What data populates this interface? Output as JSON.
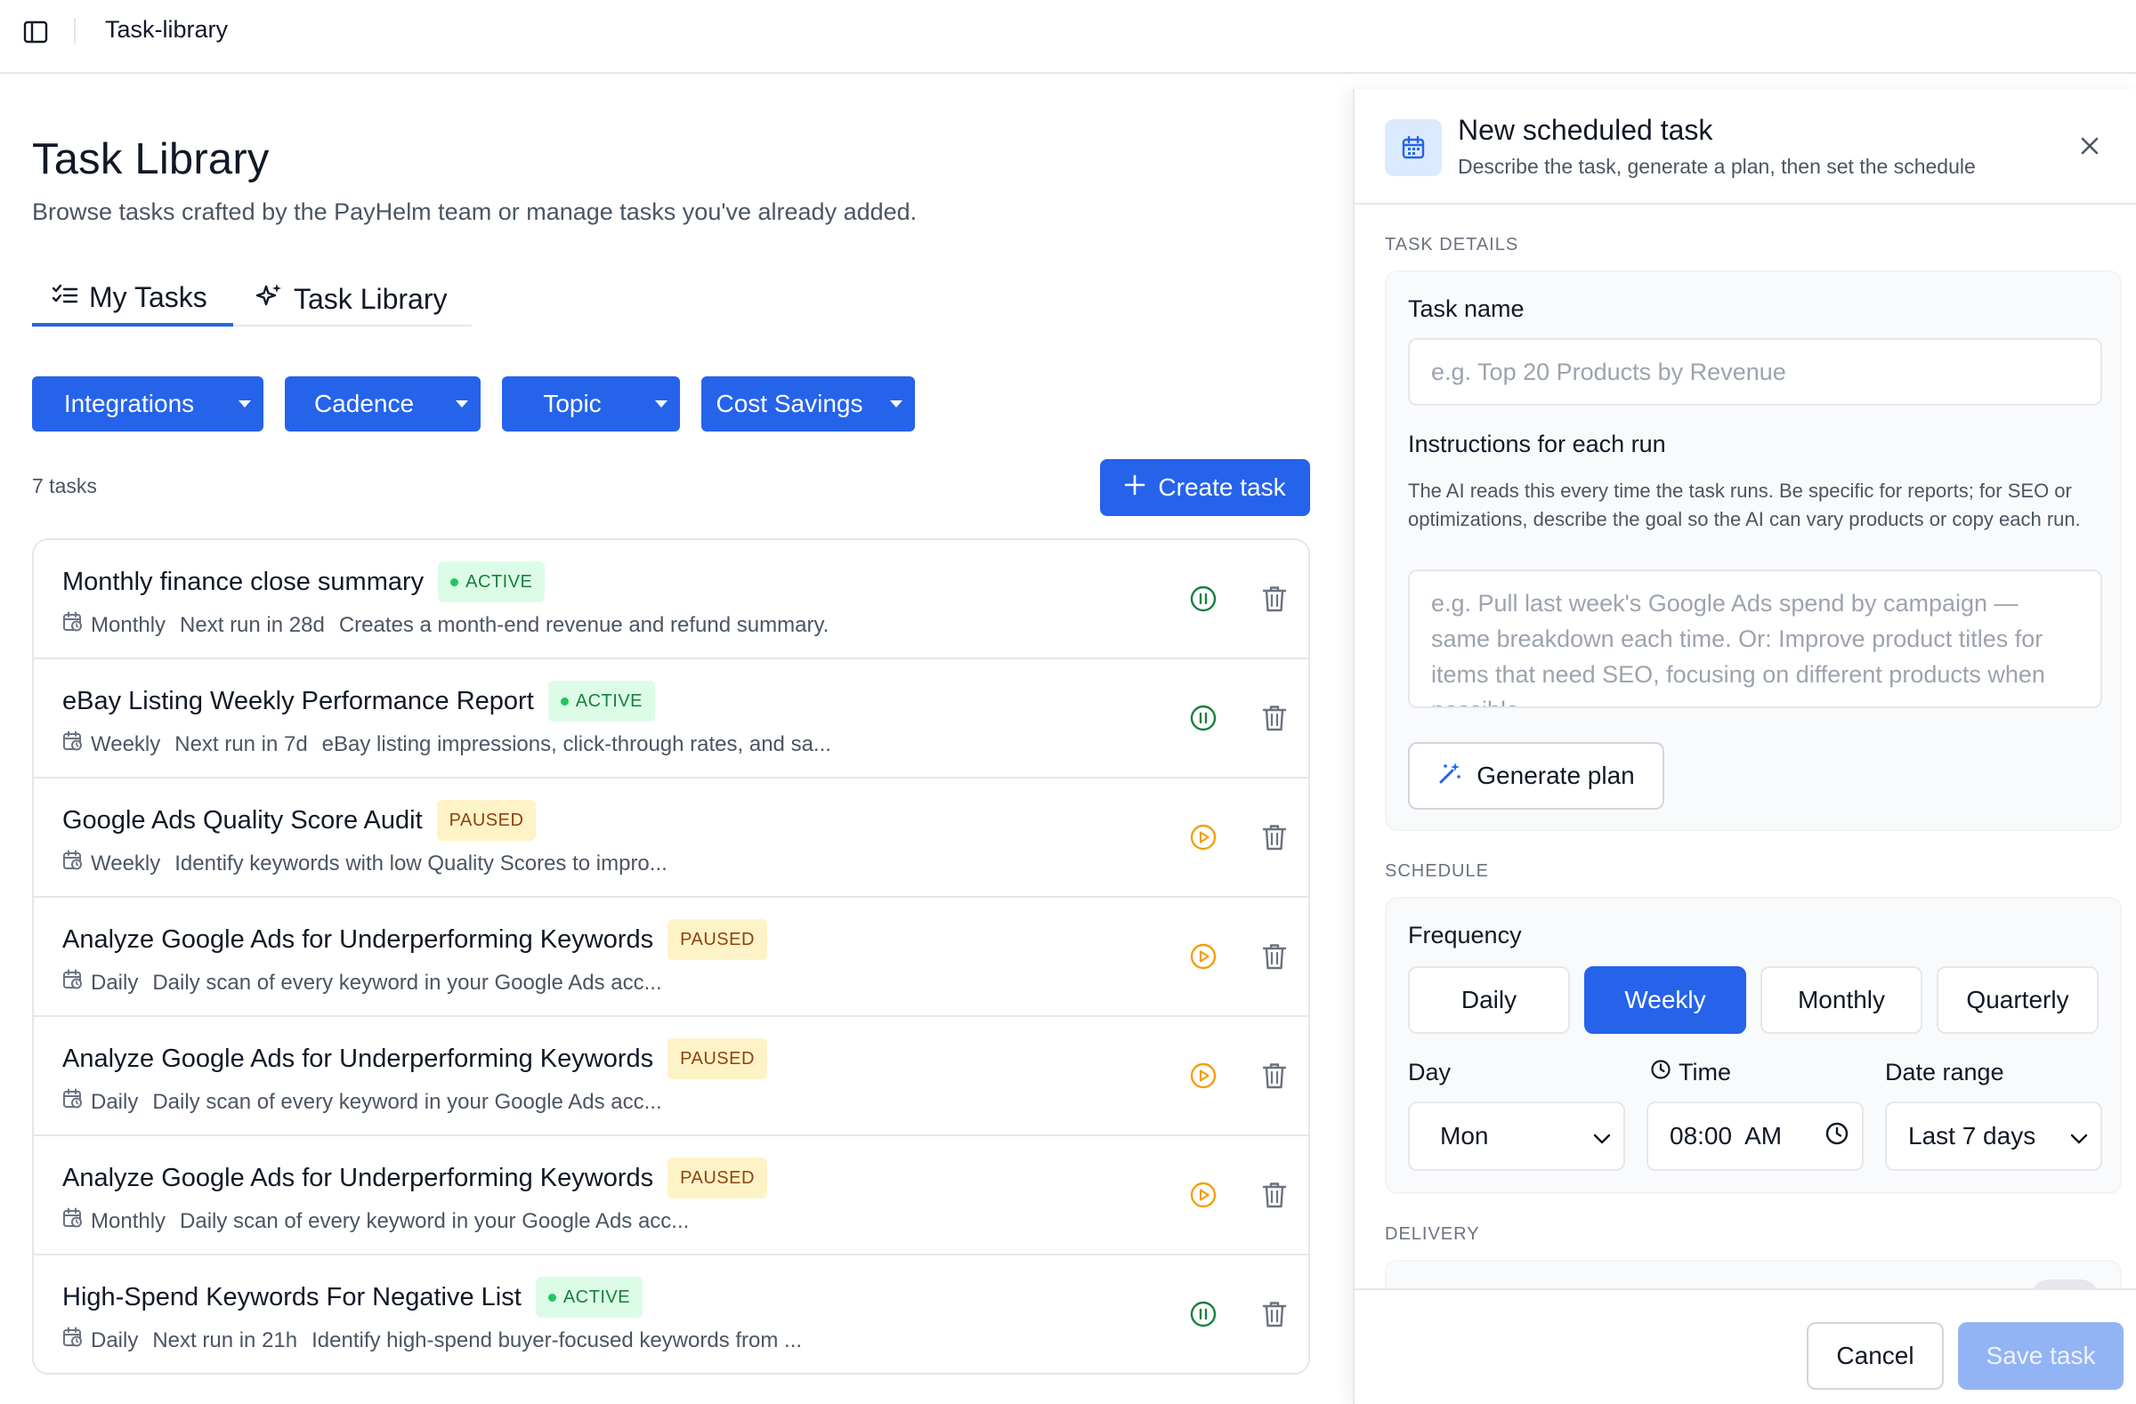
{
  "topbar": {
    "breadcrumb": "Task-library"
  },
  "page": {
    "title": "Task Library",
    "subtitle": "Browse tasks crafted by the PayHelm team or manage tasks you've already added."
  },
  "tabs": [
    {
      "label": "My Tasks",
      "icon": "checklist-icon",
      "active": true
    },
    {
      "label": "Task Library",
      "icon": "sparkles-icon",
      "active": false
    }
  ],
  "filters": [
    {
      "label": "Integrations"
    },
    {
      "label": "Cadence"
    },
    {
      "label": "Topic"
    },
    {
      "label": "Cost Savings"
    }
  ],
  "task_count": "7 tasks",
  "create_button": "Create task",
  "tasks": [
    {
      "name": "Monthly finance close summary",
      "status": "ACTIVE",
      "cadence": "Monthly",
      "next_run": "Next run in 28d",
      "description": "Creates a month-end revenue and refund summary."
    },
    {
      "name": "eBay Listing Weekly Performance Report",
      "status": "ACTIVE",
      "cadence": "Weekly",
      "next_run": "Next run in 7d",
      "description": "eBay listing impressions, click-through rates, and sa..."
    },
    {
      "name": "Google Ads Quality Score Audit",
      "status": "PAUSED",
      "cadence": "Weekly",
      "next_run": "",
      "description": "Identify keywords with low Quality Scores to impro..."
    },
    {
      "name": "Analyze Google Ads for Underperforming Keywords",
      "status": "PAUSED",
      "cadence": "Daily",
      "next_run": "",
      "description": "Daily scan of every keyword in your Google Ads acc..."
    },
    {
      "name": "Analyze Google Ads for Underperforming Keywords",
      "status": "PAUSED",
      "cadence": "Daily",
      "next_run": "",
      "description": "Daily scan of every keyword in your Google Ads acc..."
    },
    {
      "name": "Analyze Google Ads for Underperforming Keywords",
      "status": "PAUSED",
      "cadence": "Monthly",
      "next_run": "",
      "description": "Daily scan of every keyword in your Google Ads acc..."
    },
    {
      "name": "High-Spend Keywords For Negative List",
      "status": "ACTIVE",
      "cadence": "Daily",
      "next_run": "Next run in 21h",
      "description": "Identify high-spend buyer-focused keywords from ..."
    }
  ],
  "panel": {
    "title": "New scheduled task",
    "subtitle": "Describe the task, generate a plan, then set the schedule",
    "task_details_label": "TASK DETAILS",
    "task_name_label": "Task name",
    "task_name_placeholder": "e.g. Top 20 Products by Revenue",
    "task_name_value": "",
    "instructions_label": "Instructions for each run",
    "instructions_help": "The AI reads this every time the task runs. Be specific for reports; for SEO or optimizations, describe the goal so the AI can vary products or copy each run.",
    "instructions_placeholder": "e.g. Pull last week's Google Ads spend by campaign — same breakdown each time. Or: Improve product titles for items that need SEO, focusing on different products when possible.",
    "generate_button": "Generate plan",
    "schedule_label": "SCHEDULE",
    "frequency_label": "Frequency",
    "frequency_options": [
      "Daily",
      "Weekly",
      "Monthly",
      "Quarterly"
    ],
    "frequency_selected": "Weekly",
    "day_label": "Day",
    "day_value": "Mon",
    "time_label": "Time",
    "time_value": "08:00  AM",
    "date_range_label": "Date range",
    "date_range_value": "Last 7 days",
    "delivery_label": "DELIVERY",
    "cancel_button": "Cancel",
    "save_button": "Save task"
  },
  "colors": {
    "primary": "#2563eb",
    "active_badge_bg": "#dcfce7",
    "active_badge_text": "#15803d",
    "paused_badge_bg": "#fef3c7",
    "paused_badge_text": "#92400e",
    "pause_icon": "#15803d",
    "play_icon": "#f59e0b",
    "save_disabled": "#93b4f4"
  }
}
